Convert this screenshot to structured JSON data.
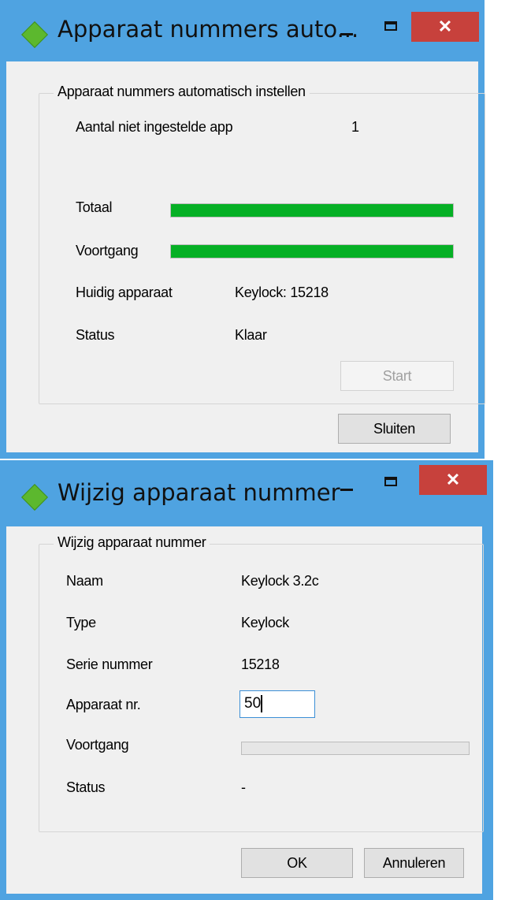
{
  "window1": {
    "title": "Apparaat nummers auto...",
    "close_glyph": "✕",
    "group_title": "Apparaat nummers automatisch instellen",
    "unset_label": "Aantal niet ingestelde app",
    "unset_value": "1",
    "total_label": "Totaal",
    "total_progress": 1.0,
    "progress_label": "Voortgang",
    "progress_value": 1.0,
    "current_label": "Huidig apparaat",
    "current_value": "Keylock: 15218",
    "status_label": "Status",
    "status_value": "Klaar",
    "start_label": "Start",
    "close_label": "Sluiten"
  },
  "window2": {
    "title": "Wijzig apparaat nummer",
    "close_glyph": "✕",
    "group_title": "Wijzig apparaat nummer",
    "name_label": "Naam",
    "name_value": "Keylock 3.2c",
    "type_label": "Type",
    "type_value": "Keylock",
    "serial_label": "Serie nummer",
    "serial_value": "15218",
    "number_label": "Apparaat nr.",
    "number_value": "50",
    "progress_label": "Voortgang",
    "progress_value": 0.0,
    "status_label": "Status",
    "status_value": "-",
    "ok_label": "OK",
    "cancel_label": "Annuleren"
  },
  "colors": {
    "title_bar": "#4fa3e1",
    "close_button": "#c7413c",
    "progress_fill": "#06b025",
    "app_icon": "#5cb82e"
  },
  "icons": {
    "app": "diamond-icon",
    "minimize": "minimize-icon",
    "maximize": "maximize-icon",
    "close": "close-icon"
  }
}
